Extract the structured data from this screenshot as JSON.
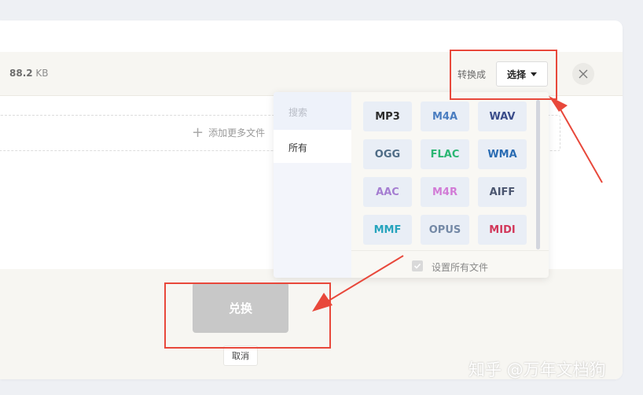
{
  "file": {
    "size_value": "88.2",
    "size_unit": " KB"
  },
  "conversion": {
    "label": "转换成",
    "select_label": "选择"
  },
  "upload": {
    "add_more": "添加更多文件"
  },
  "dropdown": {
    "search_label": "搜索",
    "category_all": "所有",
    "formats": [
      {
        "label": "MP3",
        "color": "#2c2c2c"
      },
      {
        "label": "M4A",
        "color": "#4a7dc0"
      },
      {
        "label": "WAV",
        "color": "#3a4c8a"
      },
      {
        "label": "OGG",
        "color": "#4f6c86"
      },
      {
        "label": "FLAC",
        "color": "#2bb673"
      },
      {
        "label": "WMA",
        "color": "#2a6cb3"
      },
      {
        "label": "AAC",
        "color": "#a57ed1"
      },
      {
        "label": "M4R",
        "color": "#d27bd6"
      },
      {
        "label": "AIFF",
        "color": "#4b5670"
      },
      {
        "label": "MMF",
        "color": "#26a4bd"
      },
      {
        "label": "OPUS",
        "color": "#7489a6"
      },
      {
        "label": "MIDI",
        "color": "#d2375a"
      }
    ],
    "set_all_label": "设置所有文件"
  },
  "actions": {
    "convert_label": "兑换",
    "cancel_label": "取消"
  },
  "watermark": "知乎 @万年文档狗",
  "colors": {
    "annotation": "#e8483b",
    "convert_disabled": "#c8c8c8"
  }
}
